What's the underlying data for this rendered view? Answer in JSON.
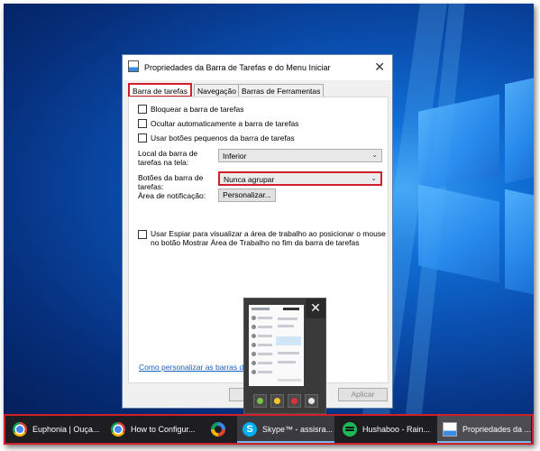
{
  "dialog": {
    "title": "Propriedades da Barra de Tarefas e do Menu Iniciar",
    "tabs": [
      {
        "label": "Barra de tarefas"
      },
      {
        "label": "Navegação"
      },
      {
        "label": "Barras de Ferramentas"
      }
    ],
    "checkboxes": {
      "lock": "Bloquear a barra de tarefas",
      "autohide": "Ocultar automaticamente a barra de tarefas",
      "small_buttons": "Usar botões pequenos da barra de tarefas",
      "peek_line1": "Usar Espiar para visualizar a área de trabalho ao posicionar o mouse",
      "peek_line2": "no botão Mostrar Área de Trabalho no fim da barra de tarefas"
    },
    "location": {
      "label_line1": "Local da barra de",
      "label_line2": "tarefas na tela:",
      "value": "Inferior"
    },
    "buttons_group": {
      "label_line1": "Botões da barra de",
      "label_line2": "tarefas:",
      "value": "Nunca agrupar"
    },
    "notification": {
      "label": "Área de notificação:",
      "button": "Personalizar..."
    },
    "help_link": "Como personalizar as barras de t",
    "apply_button": "Aplicar"
  },
  "preview": {
    "close_glyph": "✕"
  },
  "taskbar": {
    "items": [
      {
        "label": "Euphonia | Ouça...",
        "icon": "chrome-icon"
      },
      {
        "label": "How to Configur...",
        "icon": "chrome-icon"
      },
      {
        "label": "",
        "icon": "edge-icon"
      },
      {
        "label": "Skype™ - assisra...",
        "icon": "skype-icon"
      },
      {
        "label": "Hushaboo - Rain...",
        "icon": "spotify-icon"
      },
      {
        "label": "Propriedades da ...",
        "icon": "properties-icon"
      }
    ]
  },
  "colors": {
    "highlight": "#d0202a",
    "link": "#1a5fc4",
    "taskbar": "#1e1e22"
  }
}
